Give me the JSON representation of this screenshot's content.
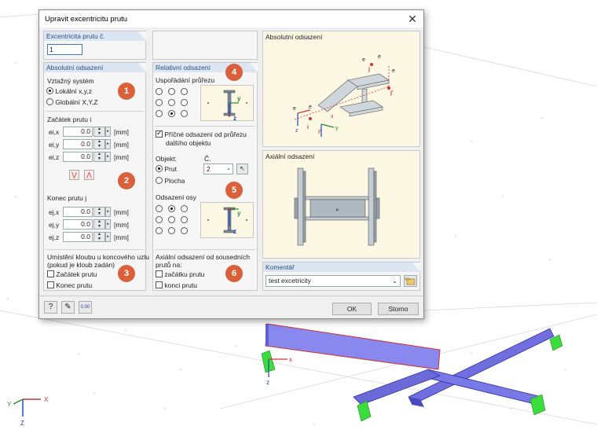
{
  "dialog": {
    "title": "Upravit excentricitu prutu",
    "close_glyph": "✕",
    "member_no": {
      "header": "Excentricita prutu č.",
      "value": "1"
    },
    "absolute": {
      "header": "Absolutní odsazení",
      "ref_system_label": "Vztažný systém",
      "local_label": "Lokální x,y,z",
      "global_label": "Globální X,Y,Z",
      "start_label": "Začátek prutu i",
      "start_rows": [
        {
          "label": "ei,x",
          "value": "0.0",
          "unit": "[mm]"
        },
        {
          "label": "ei,y",
          "value": "0.0",
          "unit": "[mm]"
        },
        {
          "label": "ei,z",
          "value": "0.0",
          "unit": "[mm]"
        }
      ],
      "end_label": "Konec prutu j",
      "end_rows": [
        {
          "label": "ej,x",
          "value": "0.0",
          "unit": "[mm]"
        },
        {
          "label": "ej,y",
          "value": "0.0",
          "unit": "[mm]"
        },
        {
          "label": "ej,z",
          "value": "0.0",
          "unit": "[mm]"
        }
      ],
      "hinge_label_1": "Umístění kloubu u koncového uzlu",
      "hinge_label_2": "(pokud je kloub zadán)",
      "hinge_start": "Začátek prutu",
      "hinge_end": "Konec prutu"
    },
    "relative": {
      "header": "Relativní odsazení",
      "cross_section_label": "Uspořádání průřezu",
      "transverse_label_1": "Příčné odsazení od průřezu",
      "transverse_label_2": "dalšího objektu",
      "object_label": "Objekt:",
      "number_label": "Č.",
      "member_opt": "Prut",
      "surface_opt": "Plocha",
      "number_value": "2",
      "axis_offset_label": "Odsazení osy",
      "axial_label_1": "Axiální odsazení od sousedních",
      "axial_label_2": "prutů na:",
      "axial_start": "začátku prutu",
      "axial_end": "konci prutu"
    },
    "preview": {
      "absolute_title": "Absolutní odsazení",
      "axial_title": "Axiální odsazení"
    },
    "comment": {
      "header": "Komentář",
      "value": "test excetricity"
    },
    "buttons": {
      "ok": "OK",
      "cancel": "Storno"
    },
    "badges": [
      "1",
      "2",
      "3",
      "4",
      "5",
      "6"
    ]
  },
  "colors": {
    "accent": "#d9603a",
    "header_bg": "#dbe6f2",
    "beam_blue": "#6f6fe0",
    "support_green": "#3ddc3d"
  }
}
